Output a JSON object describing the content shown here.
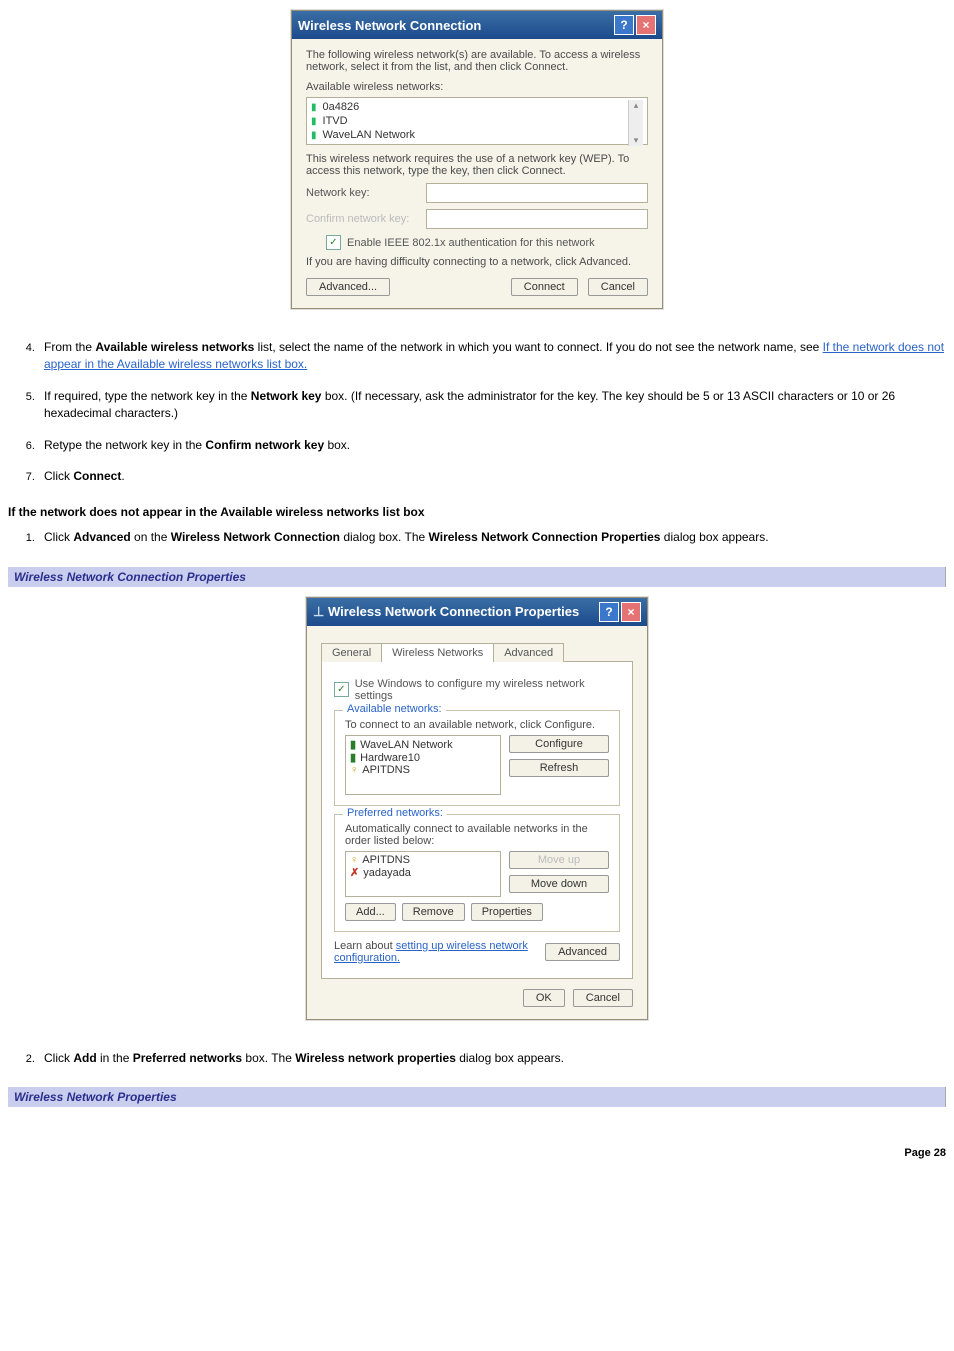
{
  "dialog1": {
    "title": "Wireless Network Connection",
    "intro": "The following wireless network(s) are available. To access a wireless network, select it from the list, and then click Connect.",
    "available_label": "Available wireless networks:",
    "networks": [
      "0a4826",
      "ITVD",
      "WaveLAN Network"
    ],
    "wep_text": "This wireless network requires the use of a network key (WEP). To access this network, type the key, then click Connect.",
    "netkey_label": "Network key:",
    "confirm_label": "Confirm network key:",
    "ieee_label": "Enable IEEE 802.1x authentication for this network",
    "difficulty_text": "If you are having difficulty connecting to a network, click Advanced.",
    "advanced_btn": "Advanced...",
    "connect_btn": "Connect",
    "cancel_btn": "Cancel"
  },
  "steps1": {
    "s4_a": "From the ",
    "s4_b": "Available wireless networks",
    "s4_c": " list, select the name of the network in which you want to connect. If you do not see the network name, see ",
    "s4_link": "If the network does not appear in the Available wireless networks list box.",
    "s5_a": "If required, type the network key in the ",
    "s5_b": "Network key",
    "s5_c": " box. (If necessary, ask the administrator for the key. The key should be 5 or 13 ASCII characters or 10 or 26 hexadecimal characters.)",
    "s6_a": "Retype the network key in the ",
    "s6_b": "Confirm network key",
    "s6_c": " box.",
    "s7_a": "Click ",
    "s7_b": "Connect",
    "s7_c": "."
  },
  "subhead1": "If the network does not appear in the Available wireless networks list box",
  "steps2": {
    "s1_a": "Click ",
    "s1_b": "Advanced",
    "s1_c": " on the ",
    "s1_d": "Wireless Network Connection",
    "s1_e": " dialog box. The ",
    "s1_f": "Wireless Network Connection Properties",
    "s1_g": " dialog box appears."
  },
  "bluebar1": "Wireless Network Connection Properties",
  "dialog2": {
    "title": "Wireless Network Connection Properties",
    "tabs": [
      "General",
      "Wireless Networks",
      "Advanced"
    ],
    "use_windows": "Use Windows to configure my wireless network settings",
    "grp_avail": "Available networks:",
    "avail_text": "To connect to an available network, click Configure.",
    "avail_list": [
      "WaveLAN Network",
      "Hardware10",
      "APITDNS"
    ],
    "configure_btn": "Configure",
    "refresh_btn": "Refresh",
    "grp_pref": "Preferred networks:",
    "pref_text": "Automatically connect to available networks in the order listed below:",
    "pref_list": [
      "APITDNS",
      "yadayada"
    ],
    "moveup_btn": "Move up",
    "movedown_btn": "Move down",
    "add_btn": "Add...",
    "remove_btn": "Remove",
    "properties_btn": "Properties",
    "learn_a": "Learn about ",
    "learn_link": "setting up wireless network configuration.",
    "advanced_btn": "Advanced",
    "ok_btn": "OK",
    "cancel_btn": "Cancel"
  },
  "steps3": {
    "s2_a": "Click ",
    "s2_b": "Add",
    "s2_c": " in the ",
    "s2_d": "Preferred networks",
    "s2_e": " box. The ",
    "s2_f": "Wireless network properties",
    "s2_g": " dialog box appears."
  },
  "bluebar2": "Wireless Network Properties",
  "page_label": "Page 28"
}
